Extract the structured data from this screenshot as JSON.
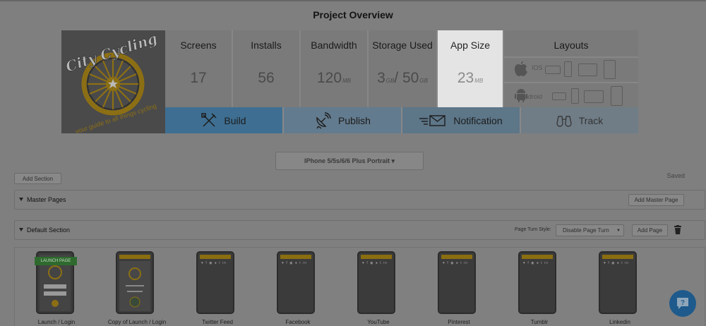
{
  "page": {
    "title": "Project Overview"
  },
  "logo": {
    "title": "City Cycling",
    "tagline": "your guide to all things cycling"
  },
  "stats": [
    {
      "label": "Screens",
      "value": "17",
      "unit": ""
    },
    {
      "label": "Installs",
      "value": "56",
      "unit": ""
    },
    {
      "label": "Bandwidth",
      "value": "120",
      "unit": "MB"
    },
    {
      "label": "Storage Used",
      "value": "3",
      "unit": "GB",
      "value2": "/ 50",
      "unit2": "GB"
    },
    {
      "label": "App Size",
      "value": "23",
      "unit": "MB"
    }
  ],
  "layouts": {
    "label": "Layouts",
    "ios": "IOS",
    "android": "Android"
  },
  "actions": {
    "build": "Build",
    "publish": "Publish",
    "notification": "Notification",
    "track": "Track"
  },
  "device_select": {
    "value": "IPhone 5/5s/6/6 Plus Portrait ▾"
  },
  "toolbar": {
    "add_section": "Add Section",
    "saved": "Saved"
  },
  "master": {
    "title": "Master Pages",
    "add_button": "Add Master Page"
  },
  "default_section": {
    "title": "Default Section",
    "page_turn_label": "Page Turn Style:",
    "page_turn_value": "Disable Page Turn",
    "add_page": "Add Page"
  },
  "screens": [
    {
      "caption": "Launch / Login",
      "badge": "LAUNCH PAGE"
    },
    {
      "caption": "Copy of Launch / Login"
    },
    {
      "caption": "Twitter Feed"
    },
    {
      "caption": "Facebook"
    },
    {
      "caption": "YouTube"
    },
    {
      "caption": "Pinterest"
    },
    {
      "caption": "Tumblr"
    },
    {
      "caption": "Linkedin"
    }
  ],
  "colors": {
    "accent_blue": "#3e6f92",
    "highlight": "#e4e4e4",
    "help": "#1e5a8c"
  }
}
